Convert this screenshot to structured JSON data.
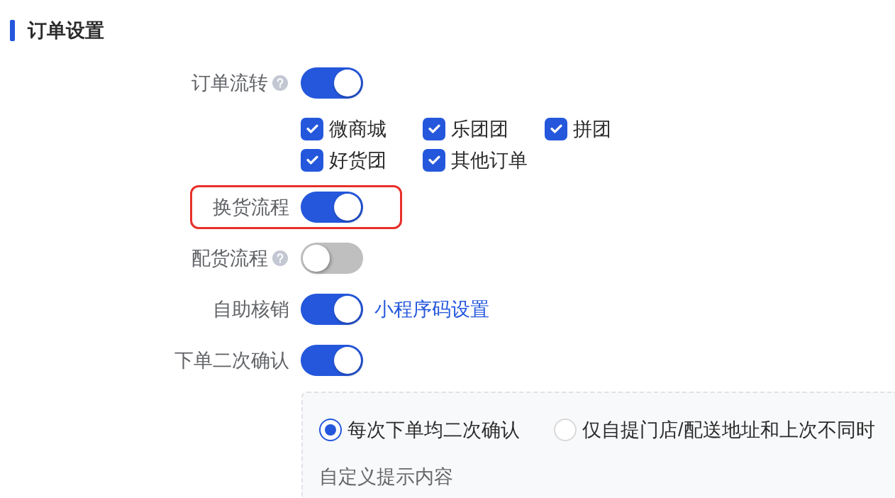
{
  "section": {
    "title": "订单设置"
  },
  "settings": [
    {
      "label": "订单流转",
      "help": true,
      "on": true,
      "highlighted": false,
      "options": [
        {
          "label": "微商城",
          "checked": true
        },
        {
          "label": "乐团团",
          "checked": true
        },
        {
          "label": "拼团",
          "checked": true
        },
        {
          "label": "好货团",
          "checked": true
        },
        {
          "label": "其他订单",
          "checked": true
        }
      ]
    },
    {
      "label": "换货流程",
      "help": false,
      "on": true,
      "highlighted": true
    },
    {
      "label": "配货流程",
      "help": true,
      "on": false,
      "highlighted": false
    },
    {
      "label": "自助核销",
      "help": false,
      "on": true,
      "highlighted": false,
      "link": "小程序码设置"
    },
    {
      "label": "下单二次确认",
      "help": false,
      "on": true,
      "highlighted": false,
      "panel": {
        "options": [
          {
            "label": "每次下单均二次确认",
            "selected": true
          },
          {
            "label": "仅自提门店/配送地址和上次不同时",
            "selected": false
          }
        ],
        "prompt_label": "自定义提示内容"
      }
    }
  ]
}
